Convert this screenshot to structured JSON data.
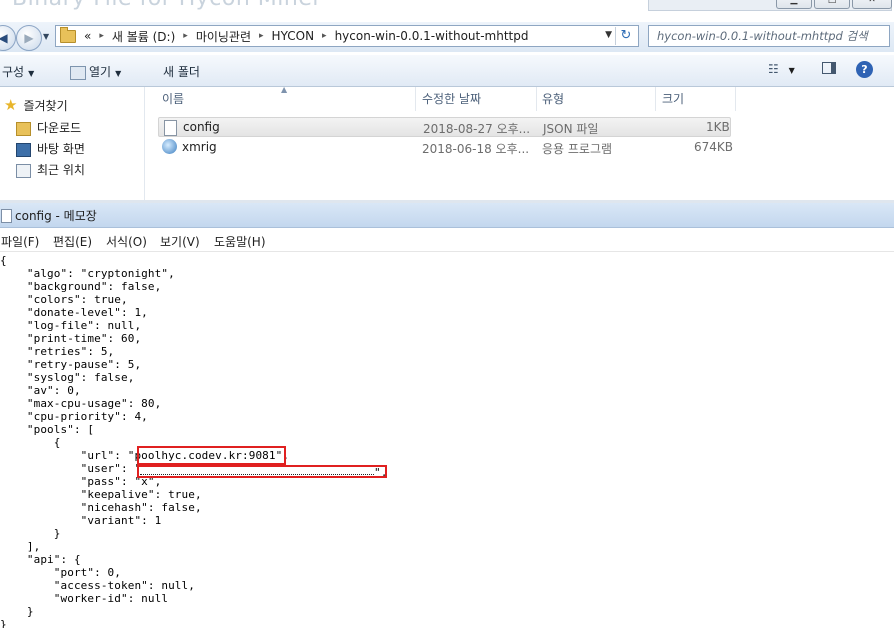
{
  "explorer": {
    "background_title": "Binary File for Hycon Miner",
    "breadcrumb": {
      "prefix": "«",
      "items": [
        "새 볼륨 (D:)",
        "마이닝관련",
        "HYCON",
        "hycon-win-0.0.1-without-mhttpd"
      ],
      "separator": "▸"
    },
    "search_placeholder": "hycon-win-0.0.1-without-mhttpd 검색",
    "toolbar": {
      "organize_label": "구성",
      "open_label": "열기",
      "new_folder_label": "새 폴더"
    },
    "navigation": {
      "favorites_label": "즐겨찾기",
      "items": [
        "다운로드",
        "바탕 화면",
        "최근 위치"
      ]
    },
    "columns": [
      "이름",
      "수정한 날짜",
      "유형",
      "크기"
    ],
    "files": [
      {
        "name": "config",
        "date": "2018-08-27 오후...",
        "type": "JSON 파일",
        "size": "1KB",
        "selected": true
      },
      {
        "name": "xmrig",
        "date": "2018-06-18 오후...",
        "type": "응용 프로그램",
        "size": "674KB",
        "selected": false
      }
    ],
    "colors": {
      "accent": "#2f63b4",
      "selection": "#e8e8e8"
    }
  },
  "notepad": {
    "title": "config - 메모장",
    "menu": [
      "파일(F)",
      "편집(E)",
      "서식(O)",
      "보기(V)",
      "도움말(H)"
    ],
    "lines": [
      "{",
      "    \"algo\": \"cryptonight\",",
      "    \"background\": false,",
      "    \"colors\": true,",
      "    \"donate-level\": 1,",
      "    \"log-file\": null,",
      "    \"print-time\": 60,",
      "    \"retries\": 5,",
      "    \"retry-pause\": 5,",
      "    \"syslog\": false,",
      "    \"av\": 0,",
      "    \"max-cpu-usage\": 80,",
      "    \"cpu-priority\": 4,",
      "    \"pools\": [",
      "        {",
      "            \"url\": \"poolhyc.codev.kr:9081\",",
      "            \"user\": \"",
      "            \"pass\": \"x\",",
      "            \"keepalive\": true,",
      "            \"nicehash\": false,",
      "            \"variant\": 1",
      "        }",
      "    ],",
      "    \"api\": {",
      "        \"port\": 0,",
      "        \"access-token\": null,",
      "        \"worker-id\": null",
      "    }",
      "}"
    ],
    "user_suffix": "\",",
    "highlight_color": "#e02020"
  }
}
